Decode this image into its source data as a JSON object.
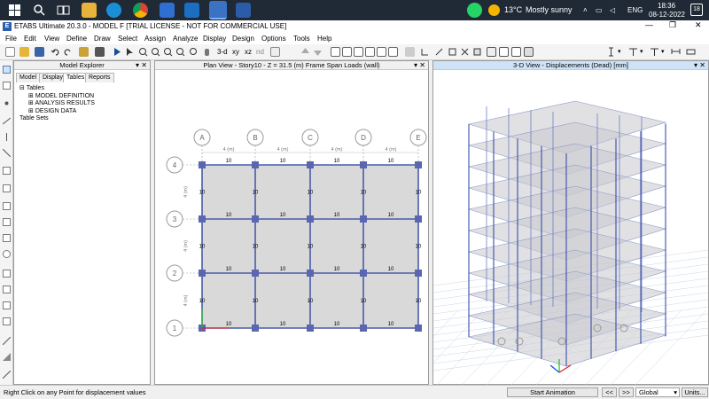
{
  "taskbar": {
    "weather_temp": "13°C",
    "weather_desc": "Mostly sunny",
    "language": "ENG",
    "time": "18:36",
    "date": "08-12-2022",
    "notifications": "18"
  },
  "window": {
    "title": "ETABS Ultimate 20.3.0 - MODEL F  [TRIAL LICENSE - NOT FOR COMMERCIAL USE]"
  },
  "menu": [
    "File",
    "Edit",
    "View",
    "Define",
    "Draw",
    "Select",
    "Assign",
    "Analyze",
    "Display",
    "Design",
    "Options",
    "Tools",
    "Help"
  ],
  "explorer": {
    "title": "Model Explorer",
    "tabs": [
      "Model",
      "Display",
      "Tables",
      "Reports"
    ],
    "selected_tab": "Tables",
    "tree": [
      {
        "label": "Tables",
        "level": 0,
        "expander": "⊟"
      },
      {
        "label": "MODEL DEFINITION",
        "level": 1,
        "expander": "⊞"
      },
      {
        "label": "ANALYSIS RESULTS",
        "level": 1,
        "expander": "⊞"
      },
      {
        "label": "DESIGN DATA",
        "level": 1,
        "expander": "⊞"
      },
      {
        "label": "Table Sets",
        "level": 0,
        "expander": ""
      }
    ]
  },
  "plan_view": {
    "title": "Plan View - Story10 - Z = 31.5 (m)  Frame Span Loads (wall)",
    "column_grid_labels": [
      "A",
      "B",
      "C",
      "D",
      "E"
    ],
    "row_grid_labels": [
      "4",
      "3",
      "2",
      "1"
    ],
    "span_dim": "4 (m)",
    "load_value": "10"
  },
  "view3d": {
    "title": "3-D View  - Displacements (Dead)  [mm]"
  },
  "status": {
    "message": "Right Click on any Point for displacement values",
    "start_animation": "Start Animation",
    "prev": "<<",
    "next": ">>",
    "coord_system": "Global",
    "units": "Units..."
  }
}
